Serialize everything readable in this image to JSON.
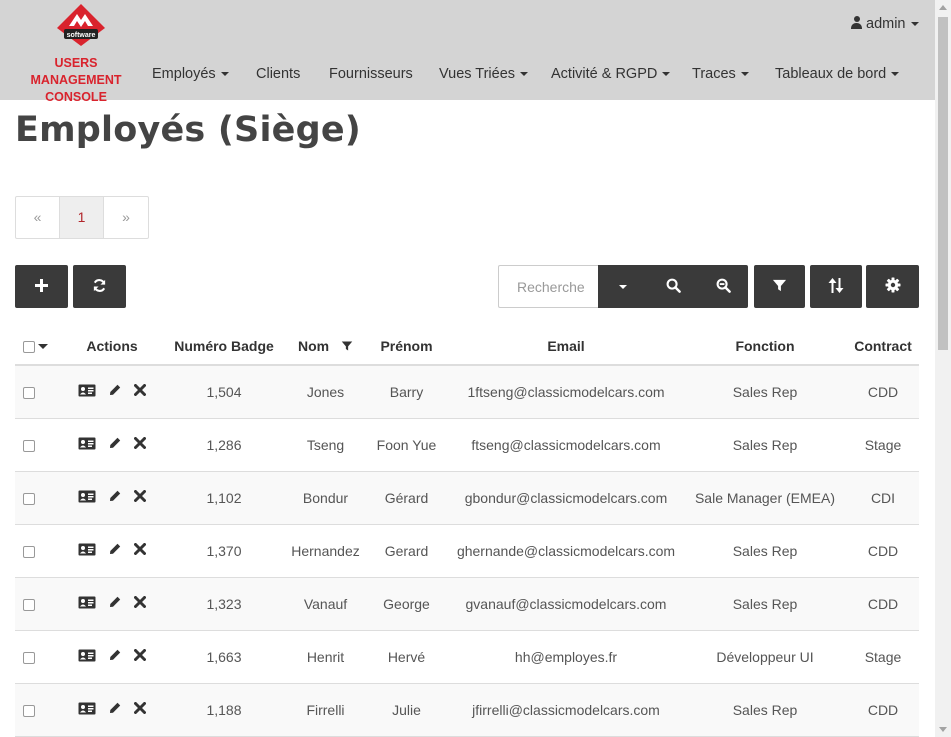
{
  "brand": {
    "logo_text": "software",
    "line1": "USERS MANAGEMENT",
    "line2": "CONSOLE",
    "accent": "#d9232d"
  },
  "nav": {
    "items": [
      {
        "label": "Employés",
        "dropdown": true
      },
      {
        "label": "Clients",
        "dropdown": false
      },
      {
        "label": "Fournisseurs",
        "dropdown": false
      },
      {
        "label": "Vues Triées",
        "dropdown": true
      },
      {
        "label": "Activité & RGPD",
        "dropdown": true
      },
      {
        "label": "Traces",
        "dropdown": true
      },
      {
        "label": "Tableaux de bord",
        "dropdown": true
      }
    ],
    "user": "admin"
  },
  "page": {
    "title": "Employés (Siège)"
  },
  "pagination": {
    "prev": "«",
    "current": "1",
    "next": "»"
  },
  "toolbar": {
    "search_placeholder": "Recherche"
  },
  "table": {
    "headers": {
      "actions": "Actions",
      "badge": "Numéro Badge",
      "nom": "Nom",
      "prenom": "Prénom",
      "email": "Email",
      "fonction": "Fonction",
      "contract": "Contract"
    },
    "rows": [
      {
        "badge": "1,504",
        "nom": "Jones",
        "prenom": "Barry",
        "email": "1ftseng@classicmodelcars.com",
        "fonction": "Sales Rep",
        "contract": "CDD"
      },
      {
        "badge": "1,286",
        "nom": "Tseng",
        "prenom": "Foon Yue",
        "email": "ftseng@classicmodelcars.com",
        "fonction": "Sales Rep",
        "contract": "Stage"
      },
      {
        "badge": "1,102",
        "nom": "Bondur",
        "prenom": "Gérard",
        "email": "gbondur@classicmodelcars.com",
        "fonction": "Sale Manager (EMEA)",
        "contract": "CDI"
      },
      {
        "badge": "1,370",
        "nom": "Hernandez",
        "prenom": "Gerard",
        "email": "ghernande@classicmodelcars.com",
        "fonction": "Sales Rep",
        "contract": "CDD"
      },
      {
        "badge": "1,323",
        "nom": "Vanauf",
        "prenom": "George",
        "email": "gvanauf@classicmodelcars.com",
        "fonction": "Sales Rep",
        "contract": "CDD"
      },
      {
        "badge": "1,663",
        "nom": "Henrit",
        "prenom": "Hervé",
        "email": "hh@employes.fr",
        "fonction": "Développeur UI",
        "contract": "Stage"
      },
      {
        "badge": "1,188",
        "nom": "Firrelli",
        "prenom": "Julie",
        "email": "jfirrelli@classicmodelcars.com",
        "fonction": "Sales Rep",
        "contract": "CDD"
      }
    ]
  }
}
